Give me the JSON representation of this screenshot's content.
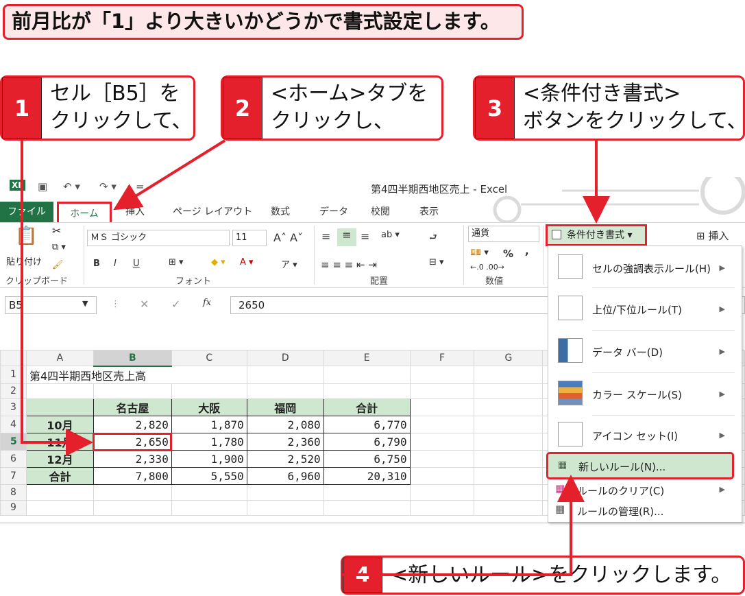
{
  "headline": "前月比が「1」より大きいかどうかで書式設定します。",
  "steps": [
    {
      "num": "1",
      "text": "セル［B5］を\nクリックして、"
    },
    {
      "num": "2",
      "text": "<ホーム>タブを\nクリックし、"
    },
    {
      "num": "3",
      "text": "<条件付き書式>\nボタンをクリックして、"
    },
    {
      "num": "4",
      "text": "<新しいルール>をクリックします。"
    }
  ],
  "window": {
    "title": "第4四半期西地区売上 - Excel",
    "app_icon": "XⅡ"
  },
  "tabs": {
    "file": "ファイル",
    "home": "ホーム",
    "insert": "挿入",
    "page_layout": "ページ レイアウト",
    "formulas": "数式",
    "data": "データ",
    "review": "校閲",
    "view": "表示"
  },
  "ribbon": {
    "paste": "貼り付け",
    "font_name": "ＭＳ ゴシック",
    "font_size": "11",
    "bold": "B",
    "italic": "I",
    "underline": "U",
    "number_format": "通貨",
    "percent": "%",
    "comma": ",",
    "conditional_format": "条件付き書式",
    "insert": "挿入",
    "groups": {
      "clipboard": "クリップボード",
      "font": "フォント",
      "alignment": "配置",
      "number": "数値"
    }
  },
  "formula_bar": {
    "name_box": "B5",
    "fx": "fx",
    "value": "2650"
  },
  "sheet": {
    "columns": [
      "A",
      "B",
      "C",
      "D",
      "E",
      "F",
      "G"
    ],
    "rows": [
      "1",
      "2",
      "3",
      "4",
      "5",
      "6",
      "7",
      "8",
      "9"
    ],
    "title": "第4四半期西地区売上高",
    "headers": [
      "名古屋",
      "大阪",
      "福岡",
      "合計"
    ],
    "data": [
      {
        "label": "10月",
        "values": [
          "2,820",
          "1,870",
          "2,080",
          "6,770"
        ]
      },
      {
        "label": "11月",
        "values": [
          "2,650",
          "1,780",
          "2,360",
          "6,790"
        ]
      },
      {
        "label": "12月",
        "values": [
          "2,330",
          "1,900",
          "2,520",
          "6,750"
        ]
      },
      {
        "label": "合計",
        "values": [
          "7,800",
          "5,550",
          "6,960",
          "20,310"
        ]
      }
    ]
  },
  "menu": {
    "items": [
      {
        "label": "セルの強調表示ルール(H)",
        "submenu": true
      },
      {
        "label": "上位/下位ルール(T)",
        "submenu": true
      },
      {
        "label": "データ バー(D)",
        "submenu": true
      },
      {
        "label": "カラー スケール(S)",
        "submenu": true
      },
      {
        "label": "アイコン セット(I)",
        "submenu": true
      }
    ],
    "new_rule": "新しいルール(N)...",
    "clear_rules": "ルールのクリア(C)",
    "manage_rules": "ルールの管理(R)..."
  },
  "colors": {
    "accent_red": "#e3202b",
    "excel_green": "#217346",
    "header_fill": "#cfe6cf"
  }
}
